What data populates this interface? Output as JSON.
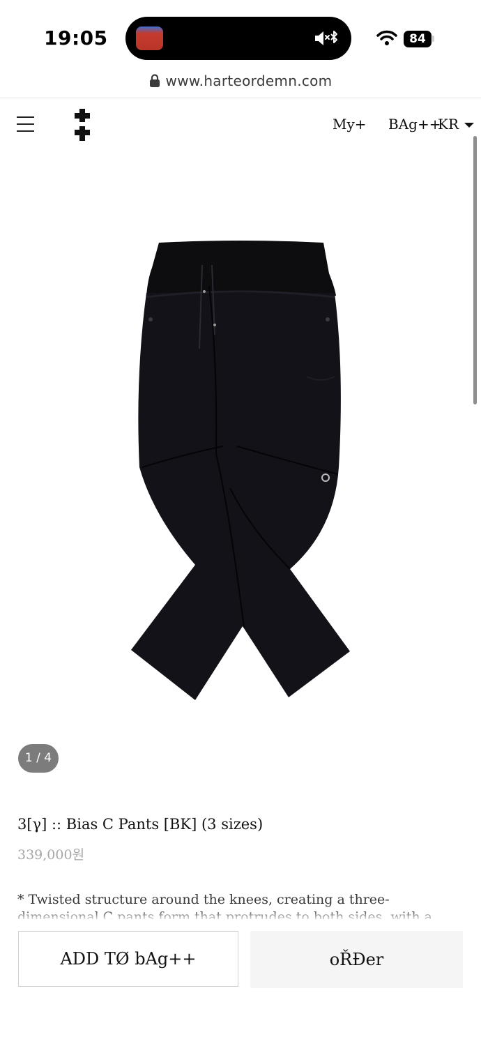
{
  "status_bar": {
    "time": "19:05",
    "battery": "84",
    "icons": [
      "app-icon",
      "mute-icon",
      "bluetooth-icon",
      "wifi-icon",
      "battery-icon"
    ]
  },
  "browser": {
    "url": "www.harteordemn.com",
    "lock_icon": "lock-icon"
  },
  "header": {
    "menu_icon": "hamburger-icon",
    "logo_icon": "double-cross-logo",
    "my": "My+",
    "bag": "BAg++",
    "lang": "KR"
  },
  "product": {
    "image_counter": "1 / 4",
    "title": "3[γ] :: Bias C Pants [BK] (3 sizes)",
    "price": "339,000원",
    "description": "* Twisted structure around the knees, creating a three-dimensional C pants form that protrudes to both sides, with a relaxed fit."
  },
  "actions": {
    "add_to_bag": "ADD TØ bAg++",
    "order": "oŘĐer"
  },
  "colors": {
    "accent": "#111111",
    "price": "#a6a6a6",
    "counter_bg": "#7c7c7c",
    "order_bg": "#f5f5f5"
  }
}
